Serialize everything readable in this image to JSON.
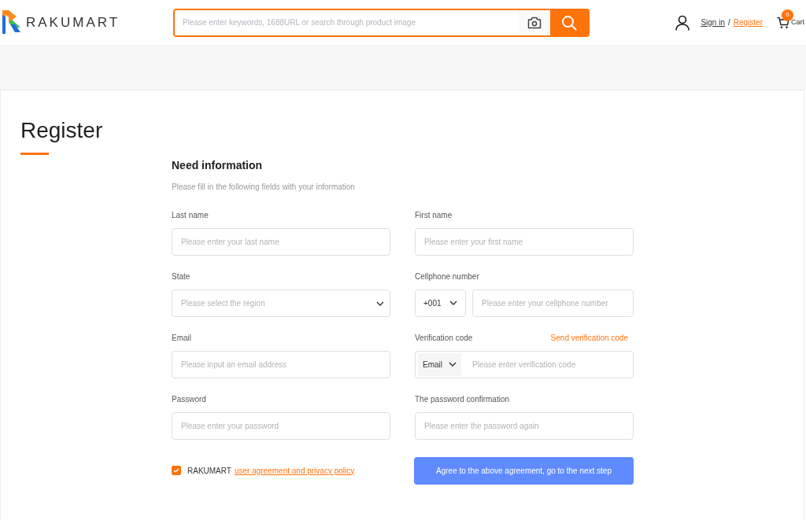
{
  "header": {
    "logo_text": "RAKUMART",
    "search": {
      "placeholder": "Please enter keywords, 1688URL or search through product image"
    },
    "sign_in": "Sign in",
    "separator": "/",
    "register": "Register",
    "cart": {
      "count": "0",
      "label": "Cart"
    }
  },
  "page": {
    "title": "Register",
    "section_title": "Need information",
    "section_hint": "Please fill in the following fields with your information"
  },
  "fields": [
    {
      "kind": "text",
      "label": "Last name",
      "placeholder": "Please enter your last name"
    },
    {
      "kind": "text",
      "label": "First name",
      "placeholder": "Please enter your first name"
    },
    {
      "kind": "select",
      "label": "State",
      "placeholder": "Please select the region"
    },
    {
      "kind": "phone",
      "label": "Cellphone number",
      "prefix": "+001",
      "placeholder": "Please enter your cellphone number"
    },
    {
      "kind": "text",
      "label": "Email",
      "placeholder": "Please input an email address"
    },
    {
      "kind": "code",
      "label": "Verification code",
      "action": "Send verification code",
      "method": "Email",
      "placeholder": "Please enter verification code"
    },
    {
      "kind": "text",
      "label": "Password",
      "placeholder": "Please enter your password"
    },
    {
      "kind": "text",
      "label": "The password confirmation",
      "placeholder": "Please enter the password again"
    }
  ],
  "agreement": {
    "checked": true,
    "text": "RAKUMART",
    "link": "user agreement and privacy policy"
  },
  "submit": "Agree to the above agreement, go to the next step"
}
